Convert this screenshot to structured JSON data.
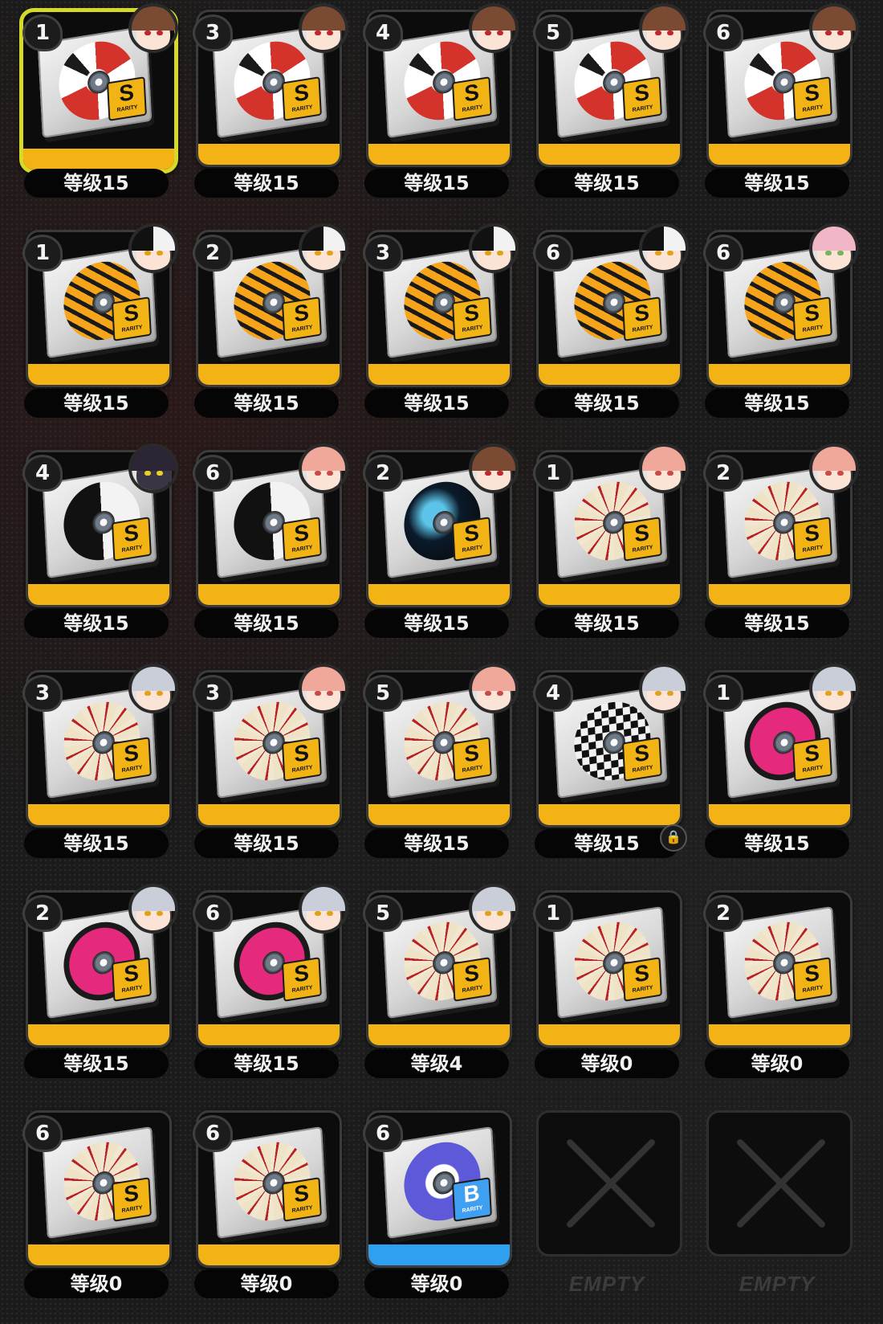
{
  "rarity_text": "RARITY",
  "colors": {
    "rarity_s": "#f2b414",
    "rarity_b": "#3fa0f2",
    "selected_border": "#d7d92a"
  },
  "grid": {
    "cells": [
      {
        "slot": "1",
        "level": "等级15",
        "rank": "S",
        "design": "red",
        "avatar": "brunette-girl",
        "selected": true
      },
      {
        "slot": "3",
        "level": "等级15",
        "rank": "S",
        "design": "red",
        "avatar": "brunette-girl"
      },
      {
        "slot": "4",
        "level": "等级15",
        "rank": "S",
        "design": "red",
        "avatar": "brunette-girl"
      },
      {
        "slot": "5",
        "level": "等级15",
        "rank": "S",
        "design": "red",
        "avatar": "brunette-girl"
      },
      {
        "slot": "6",
        "level": "等级15",
        "rank": "S",
        "design": "red",
        "avatar": "brunette-girl"
      },
      {
        "slot": "1",
        "level": "等级15",
        "rank": "S",
        "design": "tiger",
        "avatar": "black-white-hair-girl"
      },
      {
        "slot": "2",
        "level": "等级15",
        "rank": "S",
        "design": "tiger",
        "avatar": "black-white-hair-girl"
      },
      {
        "slot": "3",
        "level": "等级15",
        "rank": "S",
        "design": "tiger",
        "avatar": "black-white-hair-girl"
      },
      {
        "slot": "6",
        "level": "等级15",
        "rank": "S",
        "design": "tiger",
        "avatar": "black-white-hair-girl"
      },
      {
        "slot": "6",
        "level": "等级15",
        "rank": "S",
        "design": "tiger",
        "avatar": "pink-hair-girl"
      },
      {
        "slot": "4",
        "level": "等级15",
        "rank": "S",
        "design": "yinyang",
        "avatar": "dark-armored"
      },
      {
        "slot": "6",
        "level": "等级15",
        "rank": "S",
        "design": "yinyang",
        "avatar": "peach-hair-girl"
      },
      {
        "slot": "2",
        "level": "等级15",
        "rank": "S",
        "design": "wave",
        "avatar": "brunette-girl"
      },
      {
        "slot": "1",
        "level": "等级15",
        "rank": "S",
        "design": "flower",
        "avatar": "peach-hair-girl"
      },
      {
        "slot": "2",
        "level": "等级15",
        "rank": "S",
        "design": "flower",
        "avatar": "peach-hair-girl"
      },
      {
        "slot": "3",
        "level": "等级15",
        "rank": "S",
        "design": "flower",
        "avatar": "silver-hair-masked"
      },
      {
        "slot": "3",
        "level": "等级15",
        "rank": "S",
        "design": "flower",
        "avatar": "peach-hair-girl"
      },
      {
        "slot": "5",
        "level": "等级15",
        "rank": "S",
        "design": "flower",
        "avatar": "peach-hair-girl"
      },
      {
        "slot": "4",
        "level": "等级15",
        "rank": "S",
        "design": "checker",
        "avatar": "silver-hair-masked",
        "locked": true
      },
      {
        "slot": "1",
        "level": "等级15",
        "rank": "S",
        "design": "pink",
        "avatar": "silver-hair-masked"
      },
      {
        "slot": "2",
        "level": "等级15",
        "rank": "S",
        "design": "pink",
        "avatar": "silver-hair-masked"
      },
      {
        "slot": "6",
        "level": "等级15",
        "rank": "S",
        "design": "pink",
        "avatar": "silver-hair-masked"
      },
      {
        "slot": "5",
        "level": "等级4",
        "rank": "S",
        "design": "flower",
        "avatar": "silver-hair-masked"
      },
      {
        "slot": "1",
        "level": "等级0",
        "rank": "S",
        "design": "flower",
        "avatar": ""
      },
      {
        "slot": "2",
        "level": "等级0",
        "rank": "S",
        "design": "flower",
        "avatar": ""
      },
      {
        "slot": "6",
        "level": "等级0",
        "rank": "S",
        "design": "flower",
        "avatar": ""
      },
      {
        "slot": "6",
        "level": "等级0",
        "rank": "S",
        "design": "flower",
        "avatar": ""
      },
      {
        "slot": "6",
        "level": "等级0",
        "rank": "B",
        "design": "purple",
        "avatar": ""
      },
      {
        "empty": true,
        "empty_label": "EMPTY"
      },
      {
        "empty": true,
        "empty_label": "EMPTY"
      }
    ]
  }
}
